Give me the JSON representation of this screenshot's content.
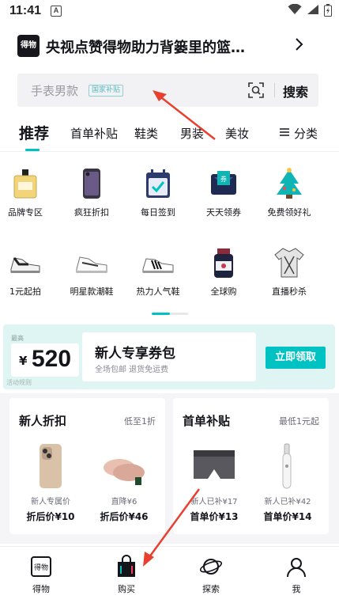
{
  "status_bar": {
    "time": "11:41",
    "notification_icon": "A"
  },
  "promo_banner": {
    "logo_text": "得物",
    "text": "央视点赞得物助力背篓里的篮…",
    "chevron_icon": "chevron-right-icon"
  },
  "search": {
    "placeholder": "手表男款",
    "badge": "国家补贴",
    "button": "搜索"
  },
  "tabs": [
    {
      "label": "推荐",
      "active": true
    },
    {
      "label": "首单补贴",
      "active": false
    },
    {
      "label": "鞋类",
      "active": false
    },
    {
      "label": "男装",
      "active": false
    },
    {
      "label": "美妆",
      "active": false
    }
  ],
  "tabs_more": "分类",
  "grid": [
    {
      "label": "品牌专区",
      "icon": "perfume-bottle-icon"
    },
    {
      "label": "疯狂折扣",
      "icon": "phone-icon"
    },
    {
      "label": "每日签到",
      "icon": "calendar-check-icon"
    },
    {
      "label": "天天领券",
      "icon": "coupon-icon"
    },
    {
      "label": "免费领好礼",
      "icon": "gift-tree-icon"
    },
    {
      "label": "1元起拍",
      "icon": "sneaker-icon"
    },
    {
      "label": "明星款潮鞋",
      "icon": "sneaker-icon"
    },
    {
      "label": "热力人气鞋",
      "icon": "sneaker-icon"
    },
    {
      "label": "全球购",
      "icon": "supplement-bottle-icon"
    },
    {
      "label": "直播秒杀",
      "icon": "jersey-icon"
    }
  ],
  "page_indicator": {
    "active_fraction": 0.5
  },
  "coupon": {
    "tag": "最高",
    "currency": "¥",
    "amount": "520",
    "title": "新人专享券包",
    "subtitle": "全场包邮 退货免运费",
    "rules": "活动规则",
    "button": "立即领取"
  },
  "deals": [
    {
      "title": "新人折扣",
      "subtitle": "低至1折",
      "products": [
        {
          "label": "新人专属价",
          "price": "折后价¥10",
          "icon": "phone-product-icon"
        },
        {
          "label": "直降¥6",
          "price": "折后价¥46",
          "icon": "slippers-icon"
        }
      ]
    },
    {
      "title": "首单补贴",
      "subtitle": "最低1元起",
      "products": [
        {
          "label": "新人已补¥17",
          "price": "首单价¥13",
          "icon": "underwear-icon"
        },
        {
          "label": "新人已补¥42",
          "price": "首单价¥14",
          "icon": "toothbrush-icon"
        }
      ]
    }
  ],
  "bottom_nav": [
    {
      "label": "得物",
      "icon": "home-logo-icon",
      "active": false
    },
    {
      "label": "购买",
      "icon": "shopping-bag-icon",
      "active": true
    },
    {
      "label": "探索",
      "icon": "planet-icon",
      "active": false
    },
    {
      "label": "我",
      "icon": "profile-icon",
      "active": false
    }
  ],
  "colors": {
    "accent": "#01c2c3",
    "arrow": "#e8402f",
    "text": "#14151a"
  }
}
